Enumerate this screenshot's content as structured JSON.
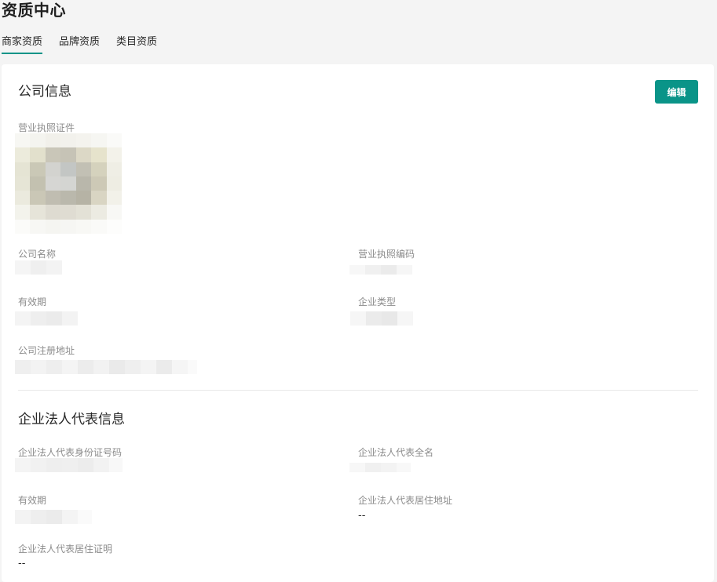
{
  "page": {
    "title": "资质中心"
  },
  "tabs": [
    {
      "label": "商家资质",
      "active": true
    },
    {
      "label": "品牌资质",
      "active": false
    },
    {
      "label": "类目资质",
      "active": false
    }
  ],
  "company_section": {
    "title": "公司信息",
    "edit_label": "编辑",
    "license_label": "营业执照证件",
    "company_name_label": "公司名称",
    "license_number_label": "营业执照编码",
    "validity_label": "有效期",
    "company_type_label": "企业类型",
    "registered_address_label": "公司注册地址"
  },
  "legal_section": {
    "title": "企业法人代表信息",
    "id_number_label": "企业法人代表身份证号码",
    "full_name_label": "企业法人代表全名",
    "validity_label": "有效期",
    "residence_address_label": "企业法人代表居住地址",
    "residence_address_value": "--",
    "residence_proof_label": "企业法人代表居住证明",
    "residence_proof_value": "--"
  },
  "colors": {
    "accent": "#0a9488",
    "background": "#f4f4f4",
    "card": "#ffffff",
    "label": "#8c8c8c"
  }
}
